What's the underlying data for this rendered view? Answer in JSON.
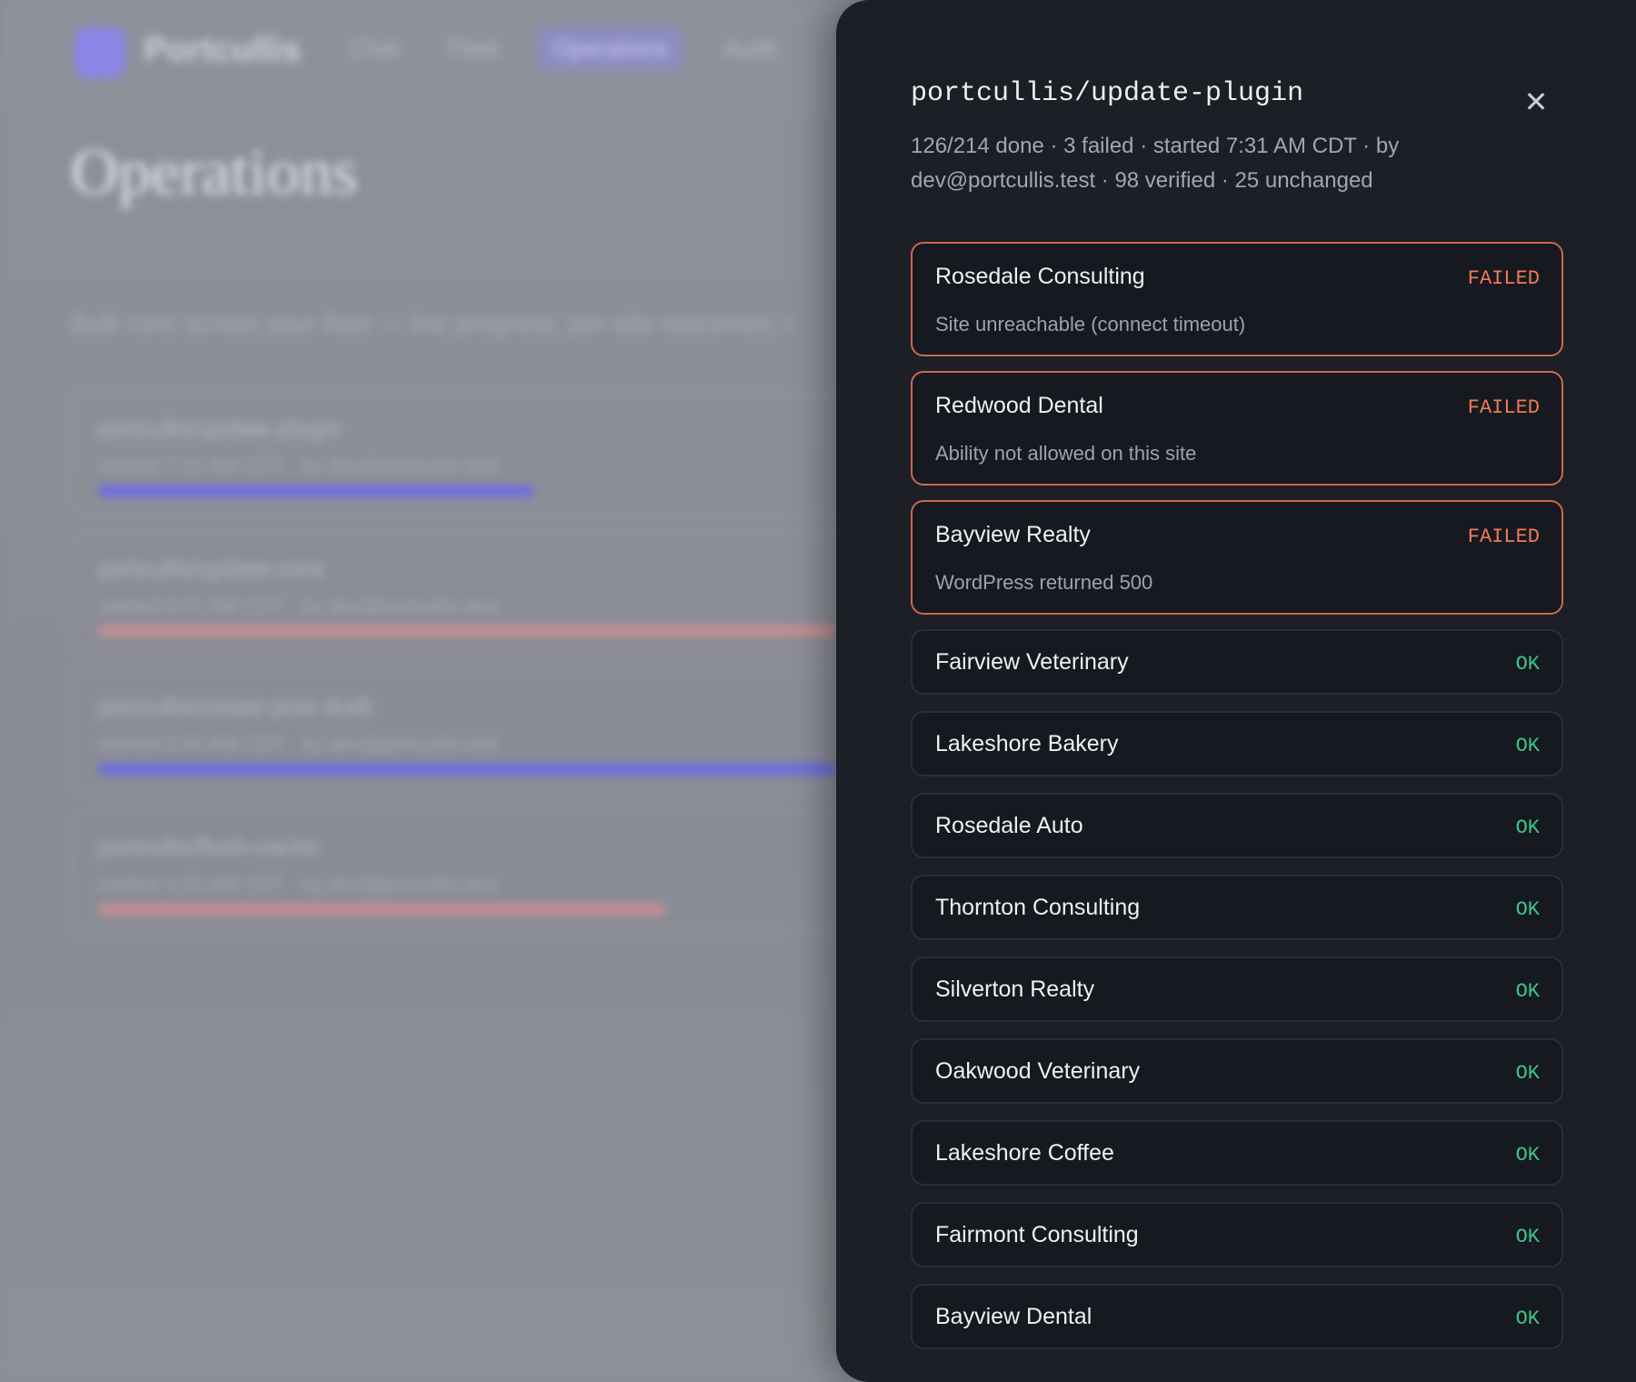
{
  "background": {
    "brand": "Portcullis",
    "nav": [
      "Chat",
      "Fleet",
      "Operations",
      "Audit"
    ],
    "active_nav": "Operations",
    "page_title": "Operations",
    "subtitle": "Bulk runs across your fleet — live progress, per-site outcomes, r",
    "operations": [
      {
        "title": "portcullis/update-plugin",
        "meta": "started 7:31 AM CDT · by dev@portcullis.test",
        "progress": 0.59,
        "color": "#6b6ce6"
      },
      {
        "title": "portcullis/update-core",
        "meta": "started 6:07 AM CDT · by dev@portcullis.test",
        "progress": 1.0,
        "color": "#c98f95"
      },
      {
        "title": "portcullis/create-post-draft",
        "meta": "started 5:45 AM CDT · by dev@portcullis.test",
        "progress": 1.0,
        "color": "#6b6ce6"
      },
      {
        "title": "portcullis/flush-cache",
        "meta": "started 4:25 AM CDT · by dev@portcullis.test",
        "progress": 0.77,
        "color": "#c98f95"
      }
    ]
  },
  "drawer": {
    "title": "portcullis/update-plugin",
    "summary": "126/214 done · 3 failed · started 7:31 AM CDT · by dev@portcullis.test · 98 verified · 25 unchanged",
    "close_icon": "close-icon",
    "colors": {
      "failed": "#f07a58",
      "ok": "#3ec58a"
    },
    "sites": [
      {
        "name": "Rosedale Consulting",
        "status": "FAILED",
        "error": "Site unreachable (connect timeout)"
      },
      {
        "name": "Redwood Dental",
        "status": "FAILED",
        "error": "Ability not allowed on this site"
      },
      {
        "name": "Bayview Realty",
        "status": "FAILED",
        "error": "WordPress returned 500"
      },
      {
        "name": "Fairview Veterinary",
        "status": "OK"
      },
      {
        "name": "Lakeshore Bakery",
        "status": "OK"
      },
      {
        "name": "Rosedale Auto",
        "status": "OK"
      },
      {
        "name": "Thornton Consulting",
        "status": "OK"
      },
      {
        "name": "Silverton Realty",
        "status": "OK"
      },
      {
        "name": "Oakwood Veterinary",
        "status": "OK"
      },
      {
        "name": "Lakeshore Coffee",
        "status": "OK"
      },
      {
        "name": "Fairmont Consulting",
        "status": "OK"
      },
      {
        "name": "Bayview Dental",
        "status": "OK"
      }
    ]
  }
}
